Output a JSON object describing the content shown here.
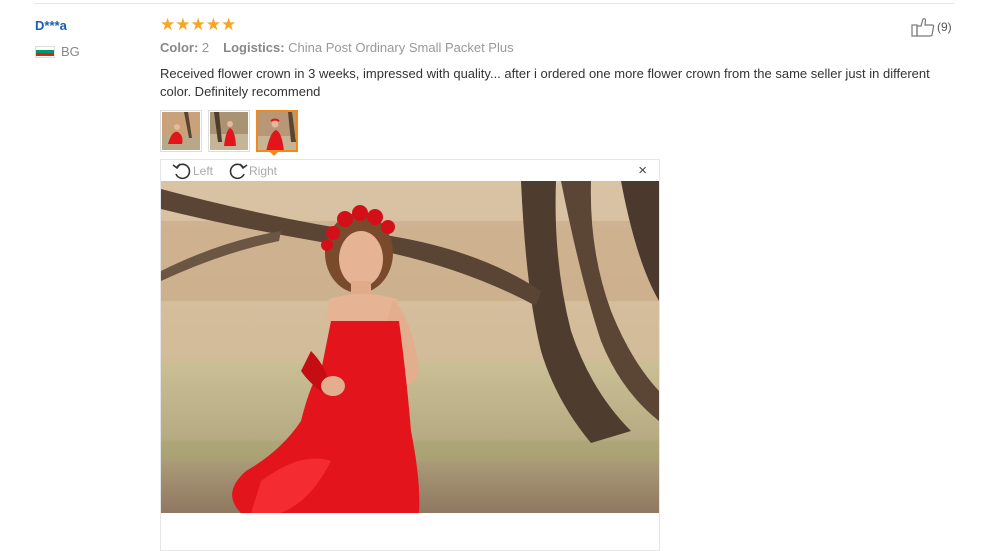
{
  "review": {
    "user": {
      "name": "D***a",
      "country": "BG"
    },
    "rating": {
      "stars": 5
    },
    "meta": {
      "color_label": "Color:",
      "color_value": "2",
      "logistics_label": "Logistics:",
      "logistics_value": "China Post Ordinary Small Packet Plus"
    },
    "text": "Received flower crown in 3 weeks, impressed with quality... after i ordered one more flower crown from the same seller just in different color. Definitely recommend",
    "helpful": {
      "count": "(9)",
      "icon": "thumbs-up-icon"
    }
  },
  "thumbnails": [
    {
      "name": "photo-1",
      "active": false
    },
    {
      "name": "photo-2",
      "active": false
    },
    {
      "name": "photo-3",
      "active": true
    }
  ],
  "viewer": {
    "rotate_left_label": "Left",
    "rotate_right_label": "Right",
    "close_label": "×"
  },
  "colors": {
    "star": "#f5a623",
    "username": "#1a5fb4",
    "active_thumb_border": "#f08a1c",
    "dress": "#e3141b"
  }
}
